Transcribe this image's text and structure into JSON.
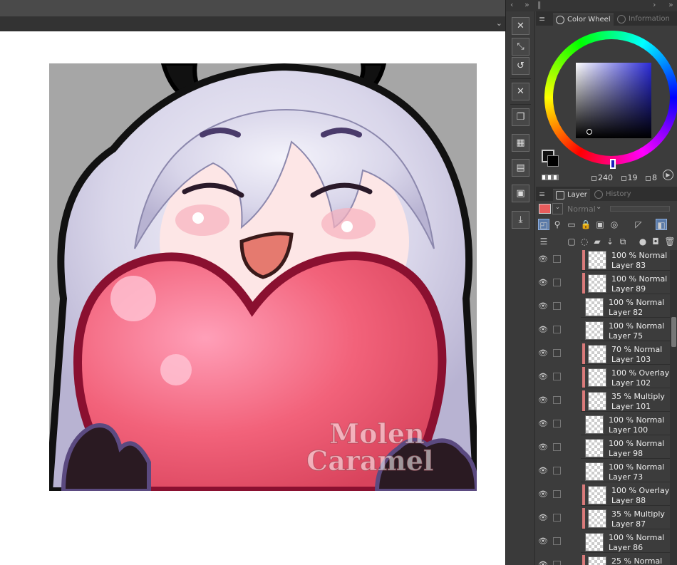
{
  "panels": {
    "color_wheel_tab": "Color Wheel",
    "information_tab": "Information",
    "layer_tab": "Layer",
    "history_tab": "History"
  },
  "color": {
    "hue": "240",
    "saturation": "19",
    "value": "8",
    "main_hex": "#111111",
    "hue_hex": "#2b2bd8"
  },
  "layer_panel": {
    "blend_mode": "Normal",
    "layer_color": "#e85c5c"
  },
  "watermark": {
    "line1": "Molen",
    "line2": "Caramel"
  },
  "layers": [
    {
      "mode": "100 % Normal",
      "name": "Layer 83",
      "clip": true,
      "mask": false
    },
    {
      "mode": "100 % Normal",
      "name": "Layer 89",
      "clip": true,
      "mask": true
    },
    {
      "mode": "100 % Normal",
      "name": "Layer 82",
      "clip": false,
      "mask": false
    },
    {
      "mode": "100 % Normal",
      "name": "Layer 75",
      "clip": false,
      "mask": false
    },
    {
      "mode": "70 % Normal",
      "name": "Layer 103",
      "clip": true,
      "mask": false
    },
    {
      "mode": "100 % Overlay",
      "name": "Layer 102",
      "clip": true,
      "mask": false
    },
    {
      "mode": "35 % Multiply",
      "name": "Layer 101",
      "clip": true,
      "mask": false
    },
    {
      "mode": "100 % Normal",
      "name": "Layer 100",
      "clip": false,
      "mask": false
    },
    {
      "mode": "100 % Normal",
      "name": "Layer 98",
      "clip": false,
      "mask": false
    },
    {
      "mode": "100 % Normal",
      "name": "Layer 73",
      "clip": false,
      "mask": true
    },
    {
      "mode": "100 % Overlay",
      "name": "Layer 88",
      "clip": true,
      "mask": false
    },
    {
      "mode": "35 % Multiply",
      "name": "Layer 87",
      "clip": true,
      "mask": false
    },
    {
      "mode": "100 % Normal",
      "name": "Layer 86",
      "clip": false,
      "mask": false
    },
    {
      "mode": "25 % Normal",
      "name": "",
      "clip": true,
      "mask": false
    }
  ]
}
